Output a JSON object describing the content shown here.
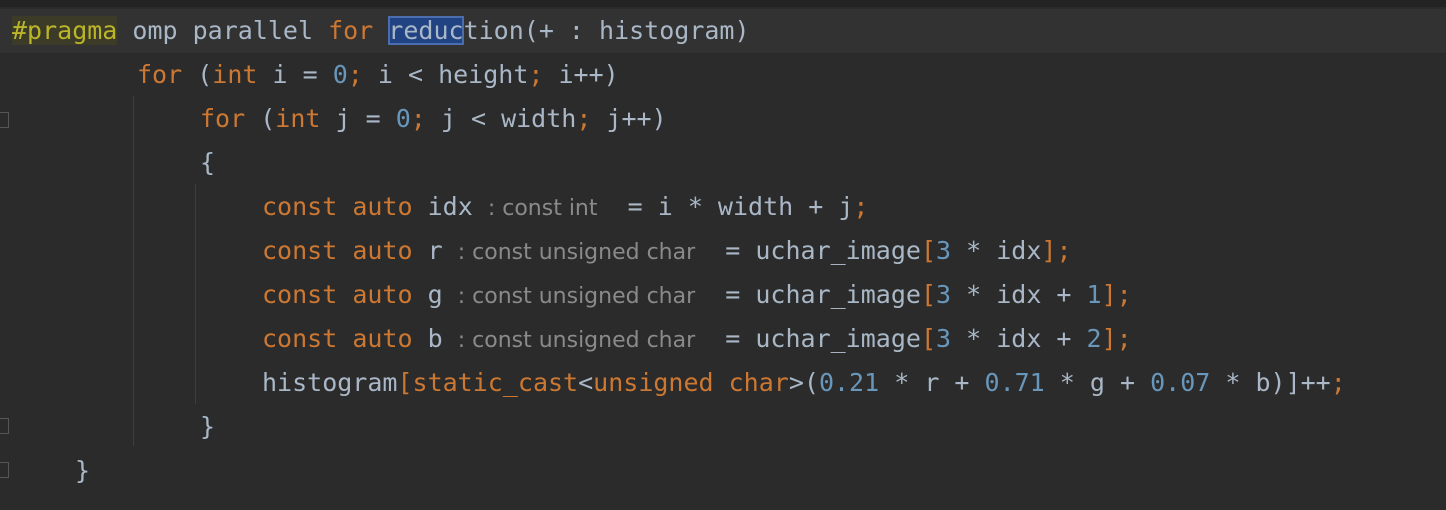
{
  "code": {
    "line1": {
      "pragma": "#pragma",
      "text1": " omp parallel ",
      "kw_for": "for",
      "sp": " ",
      "selected": "reduc",
      "rest": "tion(+ : histogram)"
    },
    "line2": {
      "kw_for": "for",
      "open": " (",
      "kw_int": "int",
      "decl": " i = ",
      "zero": "0",
      "semi1": ";",
      "cond": " i < height",
      "semi2": ";",
      "inc": " i++)"
    },
    "line3": {
      "kw_for": "for",
      "open": " (",
      "kw_int": "int",
      "decl": " j = ",
      "zero": "0",
      "semi1": ";",
      "cond": " j < width",
      "semi2": ";",
      "inc": " j++)"
    },
    "line4": {
      "brace": "{"
    },
    "line5": {
      "kw_const": "const",
      "kw_auto": "auto",
      "name": "idx",
      "hint": ": const int",
      "expr": "= i * width + j",
      "semi": ";"
    },
    "line6": {
      "kw_const": "const",
      "kw_auto": "auto",
      "name": "r",
      "hint": ": const unsigned char",
      "expr1": "= uchar_image",
      "lb": "[",
      "n1": "3",
      "expr2": " * idx",
      "rb": "]",
      "semi": ";"
    },
    "line7": {
      "kw_const": "const",
      "kw_auto": "auto",
      "name": "g",
      "hint": ": const unsigned char",
      "expr1": "= uchar_image",
      "lb": "[",
      "n1": "3",
      "expr2": " * idx + ",
      "n2": "1",
      "rb": "]",
      "semi": ";"
    },
    "line8": {
      "kw_const": "const",
      "kw_auto": "auto",
      "name": "b",
      "hint": ": const unsigned char",
      "expr1": "= uchar_image",
      "lb": "[",
      "n1": "3",
      "expr2": " * idx + ",
      "n2": "2",
      "rb": "]",
      "semi": ";"
    },
    "line9": {
      "ident": "histogram",
      "lb": "[",
      "cast": "static_cast",
      "lt": "<",
      "type": "unsigned char",
      "gt": ">(",
      "c1": "0.21",
      "t1": " * r + ",
      "c2": "0.71",
      "t2": " * g + ",
      "c3": "0.07",
      "t3": " * b)]++",
      "semi": ";"
    },
    "line10": {
      "brace": "}"
    },
    "line11": {
      "brace": "}"
    }
  },
  "colors": {
    "background": "#2b2b2b",
    "keyword": "#cc7832",
    "number": "#6897bb",
    "text": "#a9b7c6",
    "pragma": "#bbb529",
    "selection": "#214283",
    "inlay_hint": "#8a8a8a"
  }
}
